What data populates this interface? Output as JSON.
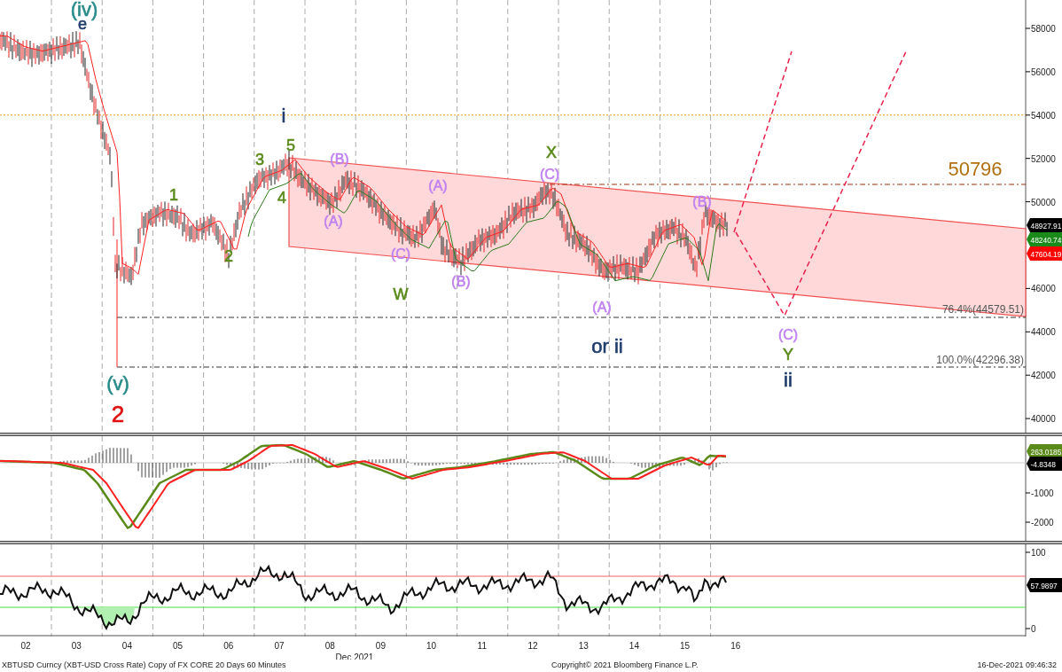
{
  "main_panel": {
    "y_axis": [
      "58000",
      "56000",
      "54000",
      "52000",
      "50000",
      "46000",
      "44000",
      "42000",
      "40000"
    ],
    "level_label": "50796",
    "fib_levels": [
      {
        "label": "76.4%(44579.51)"
      },
      {
        "label": "100.0%(42296.38)"
      }
    ],
    "wave_labels": [
      {
        "text": "(iv)",
        "color": "#2a8a8a"
      },
      {
        "text": "e",
        "color": "#1f3b6b"
      },
      {
        "text": "(v)",
        "color": "#2a8a8a"
      },
      {
        "text": "2",
        "color": "#e01010"
      },
      {
        "text": "1",
        "color": "#5a8a1a"
      },
      {
        "text": "2",
        "color": "#5a8a1a"
      },
      {
        "text": "3",
        "color": "#5a8a1a"
      },
      {
        "text": "i",
        "color": "#1f3b6b"
      },
      {
        "text": "5",
        "color": "#5a8a1a"
      },
      {
        "text": "4",
        "color": "#5a8a1a"
      },
      {
        "text": "(B)",
        "color": "#c080f0"
      },
      {
        "text": "(A)",
        "color": "#c080f0"
      },
      {
        "text": "(C)",
        "color": "#c080f0"
      },
      {
        "text": "W",
        "color": "#5a8a1a"
      },
      {
        "text": "(A)",
        "color": "#c080f0"
      },
      {
        "text": "(B)",
        "color": "#c080f0"
      },
      {
        "text": "X",
        "color": "#5a8a1a"
      },
      {
        "text": "(C)",
        "color": "#c080f0"
      },
      {
        "text": "(A)",
        "color": "#c080f0"
      },
      {
        "text": "or ii",
        "color": "#1f3b6b"
      },
      {
        "text": "(B)",
        "color": "#c080f0"
      },
      {
        "text": "(C)",
        "color": "#c080f0"
      },
      {
        "text": "Y",
        "color": "#5a8a1a"
      },
      {
        "text": "ii",
        "color": "#1f3b6b"
      }
    ],
    "price_tags": [
      {
        "value": "48927.91",
        "color": "#000000"
      },
      {
        "value": "48240.74",
        "color": "#1a8a1a"
      },
      {
        "value": "47604.19",
        "color": "#ff0000"
      }
    ]
  },
  "oscillator_panel": {
    "y_axis": [
      "-1000",
      "-2000"
    ],
    "value_tags": [
      {
        "value": "263.0185",
        "color": "#5a8a1a"
      },
      {
        "value": "-4.8348",
        "color": "#000000"
      }
    ]
  },
  "rsi_panel": {
    "y_axis": [
      "100",
      "0"
    ],
    "value_tags": [
      {
        "value": "57.9897",
        "color": "#000000"
      }
    ]
  },
  "x_axis": {
    "days": [
      "02",
      "03",
      "04",
      "05",
      "06",
      "07",
      "08",
      "09",
      "10",
      "11",
      "12",
      "13",
      "14",
      "15",
      "16"
    ],
    "month_label": "Dec 2021"
  },
  "footer": {
    "security": "XBTUSD Curncy (XBT-USD Cross Rate) Copy of FX CORE 20 Days 60 Minutes",
    "copyright": "Copyright© 2021 Bloomberg Finance L.P.",
    "timestamp": "16-Dec-2021 09:46:32"
  }
}
